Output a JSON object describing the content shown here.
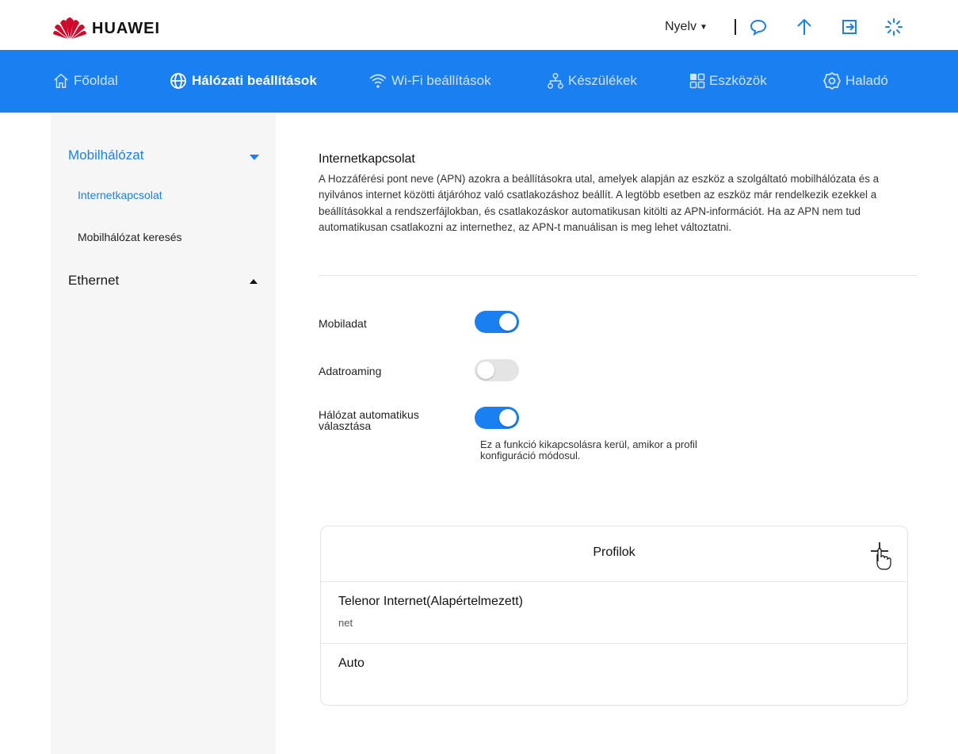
{
  "header": {
    "brand": "HUAWEI",
    "language_label": "Nyelv",
    "icons": [
      "chat-icon",
      "upload-arrow-icon",
      "logout-icon",
      "loading-spinner-icon"
    ]
  },
  "nav": {
    "items": [
      {
        "label": "Főoldal",
        "icon": "home-icon",
        "active": false
      },
      {
        "label": "Hálózati beállítások",
        "icon": "globe-icon",
        "active": true
      },
      {
        "label": "Wi-Fi beállítások",
        "icon": "wifi-icon",
        "active": false
      },
      {
        "label": "Készülékek",
        "icon": "devices-icon",
        "active": false
      },
      {
        "label": "Eszközök",
        "icon": "tools-grid-icon",
        "active": false
      },
      {
        "label": "Haladó",
        "icon": "gear-icon",
        "active": false
      }
    ]
  },
  "sidebar": {
    "groups": [
      {
        "label": "Mobilhálózat",
        "expanded": true,
        "items": [
          {
            "label": "Internetkapcsolat",
            "active": true
          },
          {
            "label": "Mobilhálózat keresés",
            "active": false
          }
        ]
      },
      {
        "label": "Ethernet",
        "expanded": false,
        "items": []
      }
    ]
  },
  "main": {
    "title": "Internetkapcsolat",
    "description": "A Hozzáférési pont neve (APN) azokra a beállításokra utal, amelyek alapján az eszköz a szolgáltató mobilhálózata és a nyilvános internet közötti átjáróhoz való csatlakozáshoz beállít. A legtöbb esetben az eszköz már rendelkezik ezekkel a beállításokkal a rendszerfájlokban, és csatlakozáskor automatikusan kitölti az APN-információt. Ha az APN nem tud automatikusan csatlakozni az internethez, az APN-t manuálisan is meg lehet változtatni.",
    "settings": [
      {
        "label": "Mobiladat",
        "enabled": true
      },
      {
        "label": "Adatroaming",
        "enabled": false
      },
      {
        "label": "Hálózat automatikus választása",
        "enabled": true,
        "hint": "Ez a funkció kikapcsolásra kerül, amikor a profil konfiguráció módosul."
      }
    ]
  },
  "profiles": {
    "title": "Profilok",
    "items": [
      {
        "name": "Telenor Internet(Alapértelmezett)",
        "apn": "net"
      },
      {
        "name": "Auto",
        "apn": ""
      }
    ]
  },
  "colors": {
    "accent": "#1a7ff0",
    "nav_bg": "#1a7ff0",
    "brand_red": "#cf0a2c",
    "toggle_off": "#e4e4e4",
    "sidebar_bg": "#f6f6f6"
  }
}
